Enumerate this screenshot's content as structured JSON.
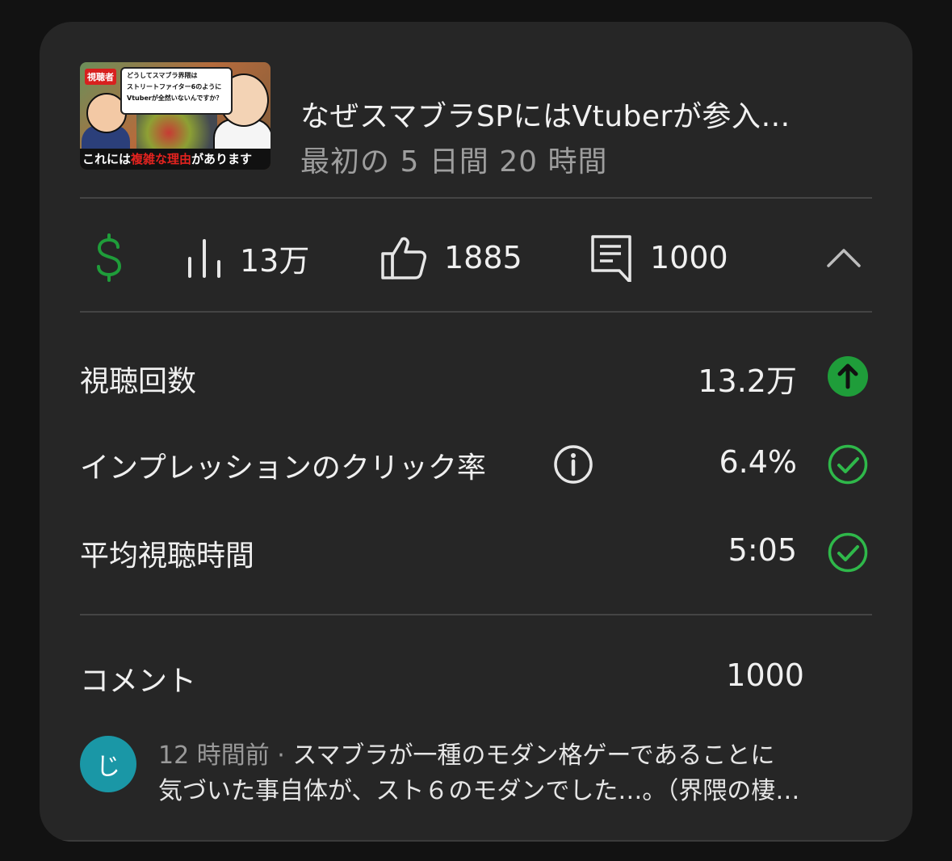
{
  "video": {
    "title": "なぜスマブラSPにはVtuberが参入…",
    "period": "最初の 5 日間 20 時間",
    "thumbnail": {
      "tag": "視聴者",
      "bubble_lines": [
        "どうしてスマブラ界隈は",
        "ストリートファイター6のように",
        "Vtuberが全然いないんですか？"
      ],
      "caption_pre": "これには",
      "caption_red": "複雑な理由",
      "caption_post": "があります"
    }
  },
  "stats": {
    "views": "13万",
    "likes": "1885",
    "comments": "1000"
  },
  "metrics": [
    {
      "label": "視聴回数",
      "value": "13.2万",
      "status": "up-arrow-icon"
    },
    {
      "label": "インプレッションのクリック率",
      "value": "6.4%",
      "status": "check-circle-icon"
    },
    {
      "label": "平均視聴時間",
      "value": "5:05",
      "status": "check-circle-icon"
    }
  ],
  "comments_section": {
    "label": "コメント",
    "count": "1000",
    "latest": {
      "avatar_letter": "じ",
      "time": "12 時間前",
      "separator": " · ",
      "text_line1": "スマブラが一種のモダン格ゲーであることに",
      "text_line2": "気づいた事自体が、スト６のモダンでした…。（界隈の棲…"
    }
  },
  "colors": {
    "background": "#121212",
    "card": "#262626",
    "green": "#1f9d3a",
    "check_green": "#2fb84a",
    "avatar": "#1a97a6"
  }
}
